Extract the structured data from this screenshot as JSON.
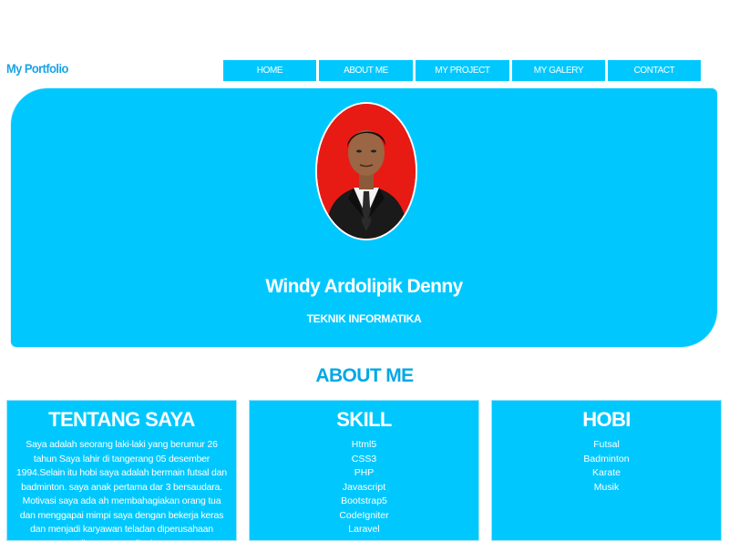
{
  "brand": "My Portfolio",
  "nav": [
    {
      "label": "HOME"
    },
    {
      "label": "ABOUT ME"
    },
    {
      "label": "MY PROJECT"
    },
    {
      "label": "MY GALERY"
    },
    {
      "label": "CONTACT"
    }
  ],
  "hero": {
    "name": "Windy Ardolipik Denny",
    "major": "TEKNIK INFORMATIKA"
  },
  "about_title": "ABOUT ME",
  "cards": {
    "tentang": {
      "title": "TENTANG SAYA",
      "text": "Saya adalah seorang laki-laki yang berumur 26 tahun Saya lahir di tangerang 05 desember 1994.Selain itu hobi saya adalah bermain futsal dan badminton. saya anak pertama dar 3 bersaudara. Motivasi saya ada ah membahagiakan orang tua dan menggapai mimpi saya dengan bekerja keras dan menjadi karyawan teladan diperusahaan dimana saya diterima"
    },
    "skill": {
      "title": "SKILL",
      "items": [
        "Html5",
        "CSS3",
        "PHP",
        "Javascript",
        "Bootstrap5",
        "CodeIgniter",
        "Laravel"
      ]
    },
    "hobi": {
      "title": "HOBI",
      "items": [
        "Futsal",
        "Badminton",
        "Karate",
        "Musik"
      ]
    }
  },
  "colors": {
    "accent": "#00c8ff",
    "brand": "#1aa3e6",
    "photo_bg": "#e81a14"
  }
}
